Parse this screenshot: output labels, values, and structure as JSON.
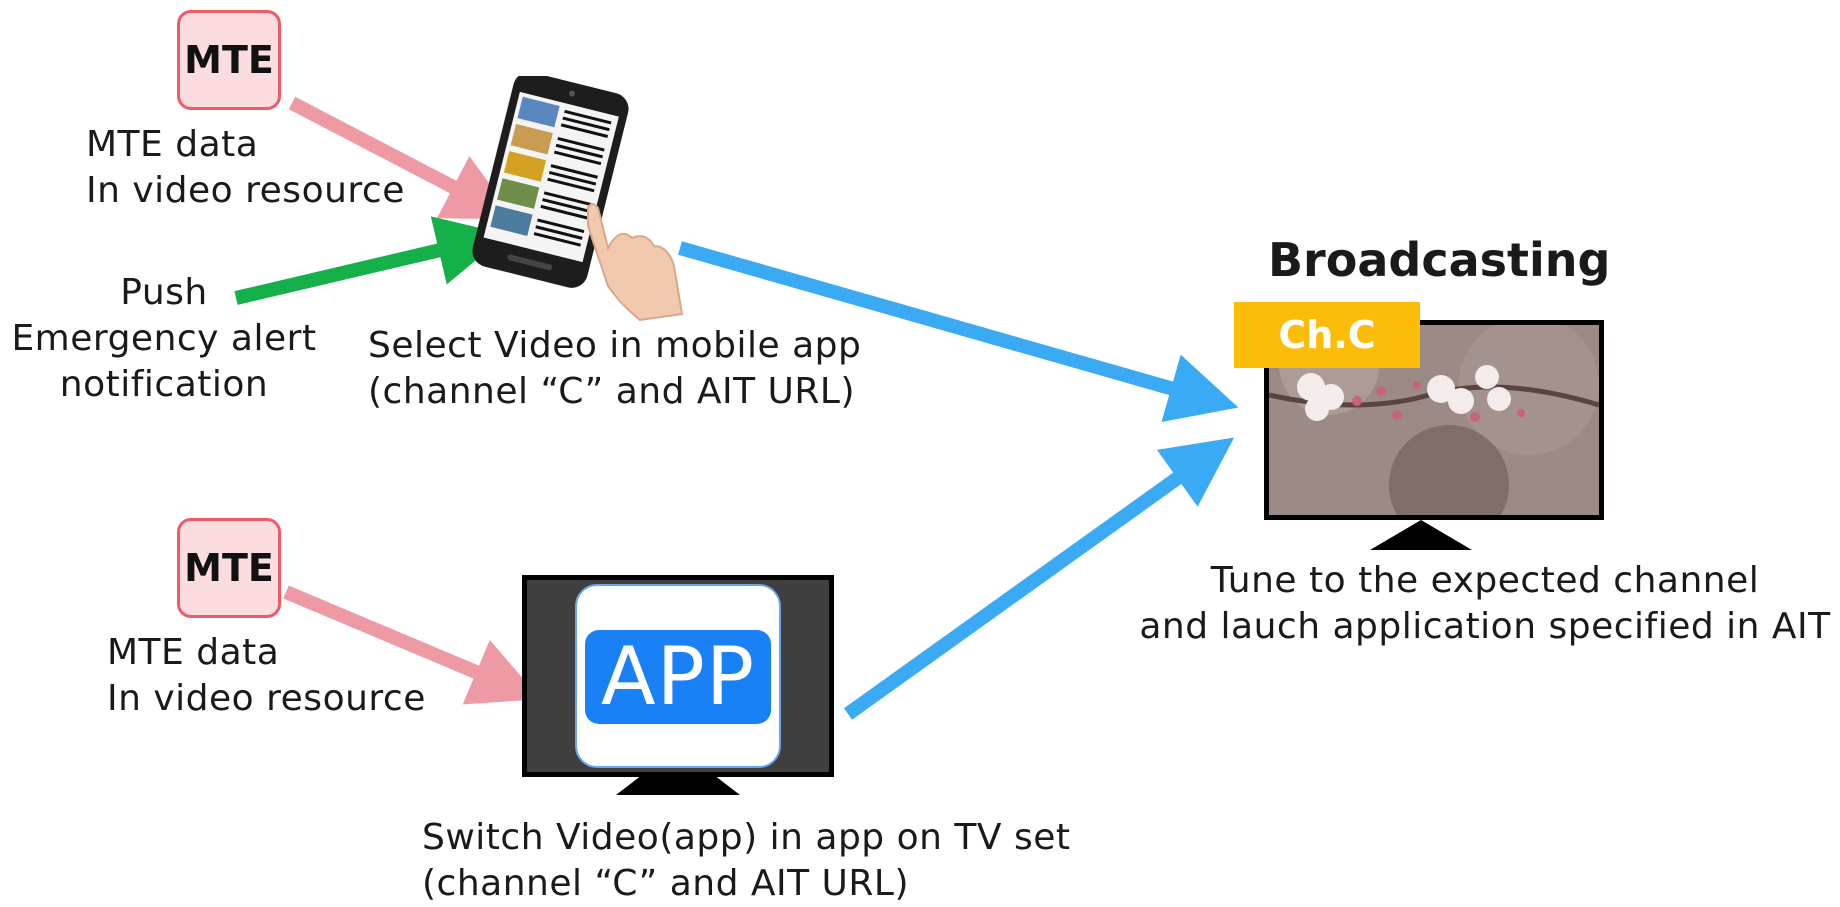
{
  "top": {
    "mte_badge": "MTE",
    "mte_caption_line1": "MTE data",
    "mte_caption_line2": "In video resource",
    "push_line1": "Push",
    "push_line2": "Emergency alert",
    "push_line3": "notification",
    "mobile_caption_line1": "Select Video in mobile app",
    "mobile_caption_line2": "(channel “C” and AIT URL)"
  },
  "bottom": {
    "mte_badge": "MTE",
    "mte_caption_line1": "MTE data",
    "mte_caption_line2": "In video resource",
    "app_label": "APP",
    "tv_caption_line1": "Switch Video(app) in app on TV set",
    "tv_caption_line2": "(channel “C” and AIT URL)"
  },
  "broadcast": {
    "title": "Broadcasting",
    "channel_badge": "Ch.C",
    "caption_line1": "Tune to the expected channel",
    "caption_line2": "and lauch application specified in AIT"
  },
  "colors": {
    "mte_arrow": "#ee9aa5",
    "push_arrow": "#16b04a",
    "flow_arrow": "#3aaaf4",
    "channel_badge": "#fbbd0a",
    "app_blue": "#1a80f5"
  }
}
